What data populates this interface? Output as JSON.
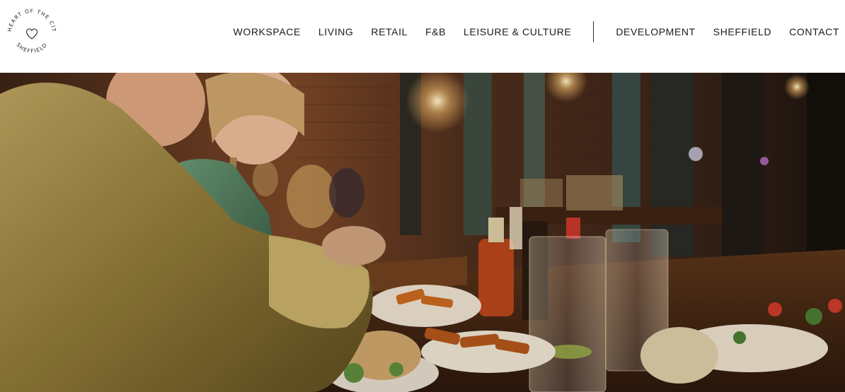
{
  "logo": {
    "ring_text_top": "HEART OF THE CITY",
    "ring_text_bottom": "SHEFFIELD",
    "icon": "heart-icon"
  },
  "nav": {
    "primary": [
      {
        "label": "WORKSPACE"
      },
      {
        "label": "LIVING"
      },
      {
        "label": "RETAIL"
      },
      {
        "label": "F&B"
      },
      {
        "label": "LEISURE & CULTURE"
      }
    ],
    "secondary": [
      {
        "label": "DEVELOPMENT"
      },
      {
        "label": "SHEFFIELD"
      },
      {
        "label": "CONTACT"
      }
    ]
  },
  "colors": {
    "background": "#ffffff",
    "nav_text": "#1b1b1b",
    "divider": "#333333"
  }
}
